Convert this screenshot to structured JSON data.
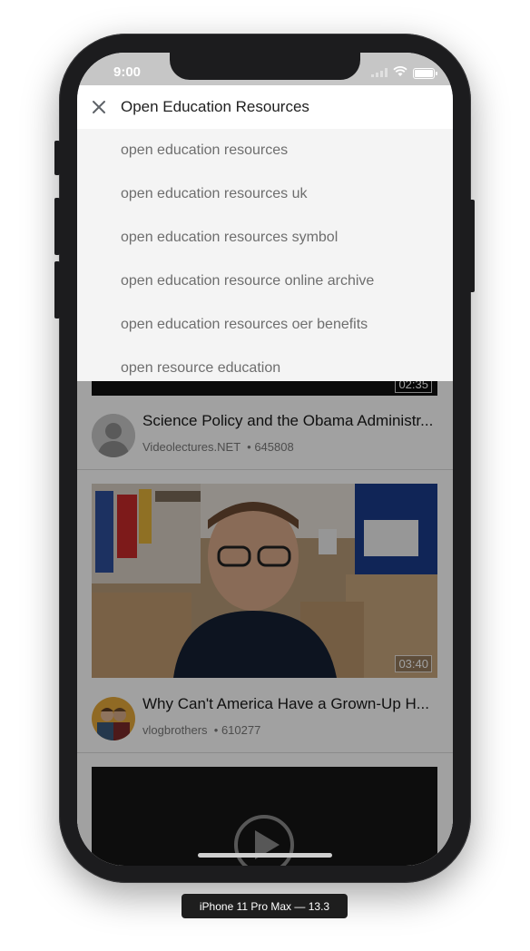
{
  "status_bar": {
    "time": "9:00"
  },
  "search": {
    "query": "Open Education Resources",
    "close_icon": "close-icon"
  },
  "suggestions": [
    "open education resources",
    "open education resources uk",
    "open education resources symbol",
    "open education resource online archive",
    "open education resources oer benefits",
    "open resource education"
  ],
  "videos": [
    {
      "duration": "02:35",
      "title": "Science Policy and the Obama Administr...",
      "channel": "Videolectures.NET",
      "views": "645808"
    },
    {
      "duration": "03:40",
      "title": "Why Can't America Have a Grown-Up H...",
      "channel": "vlogbrothers",
      "views": "610277"
    }
  ],
  "device_label": "iPhone 11 Pro Max — 13.3"
}
